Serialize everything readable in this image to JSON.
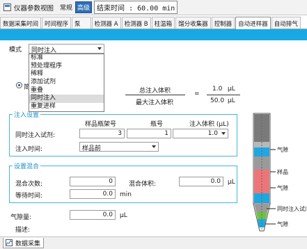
{
  "window": {
    "title": "仪器参数视图",
    "mode_buttons": [
      "常规",
      "高级"
    ],
    "active_mode": "高级",
    "end_time": "结束时间 : 60.00 min"
  },
  "tabs": [
    {
      "label": "数据采集时间"
    },
    {
      "label": "时间程序"
    },
    {
      "label": "泵"
    },
    {
      "label": "检测器 A"
    },
    {
      "label": "检测器 B"
    },
    {
      "label": "柱温箱"
    },
    {
      "label": "馏分收集器"
    },
    {
      "label": "控制器"
    },
    {
      "label": "自动进样器",
      "active": true
    },
    {
      "label": "自动排气"
    }
  ],
  "mode": {
    "label": "模式",
    "value": "同时注入",
    "options": [
      "标准",
      "预处理程序",
      "稀释",
      "添加试剂",
      "重叠",
      "同时注入",
      "重复进样"
    ]
  },
  "simple_radio_label": "简",
  "formula": {
    "numerator_label": "总注入体积",
    "denominator_label": "最大注入体积",
    "equals": "=",
    "numerator_value": "1.0",
    "denominator_value": "50.0",
    "unit": "μL"
  },
  "inject_settings": {
    "legend": "注入设置",
    "col_rack": "样品瓶架号",
    "col_vial": "瓶号",
    "col_volume": "注入体积 (μL)",
    "row1_label": "同时注入试剂:",
    "rack_value": "3",
    "vial_value": "1",
    "volume_value": "1.0",
    "time_label": "注入时间:",
    "time_value": "样品前"
  },
  "mix_settings": {
    "legend": "设置混合",
    "count_label": "混合次数:",
    "count_value": "0",
    "volume_label": "混合体积:",
    "volume_value": "0.0",
    "volume_unit": "μL",
    "wait_label": "等待时间:",
    "wait_value": "0.0",
    "wait_unit": "min"
  },
  "gap": {
    "label": "气隙量:",
    "value": "0.0",
    "unit": "μL"
  },
  "description_label": "描述:",
  "syringe": {
    "labels": [
      "气隙",
      "样品",
      "气隙",
      "同时注入试剂",
      "气隙"
    ],
    "colors": {
      "air": "#1ea7e1",
      "sample": "#ee7577",
      "reagent": "#6fc23b"
    }
  },
  "statusbar": {
    "tab_label": "数据采集"
  }
}
